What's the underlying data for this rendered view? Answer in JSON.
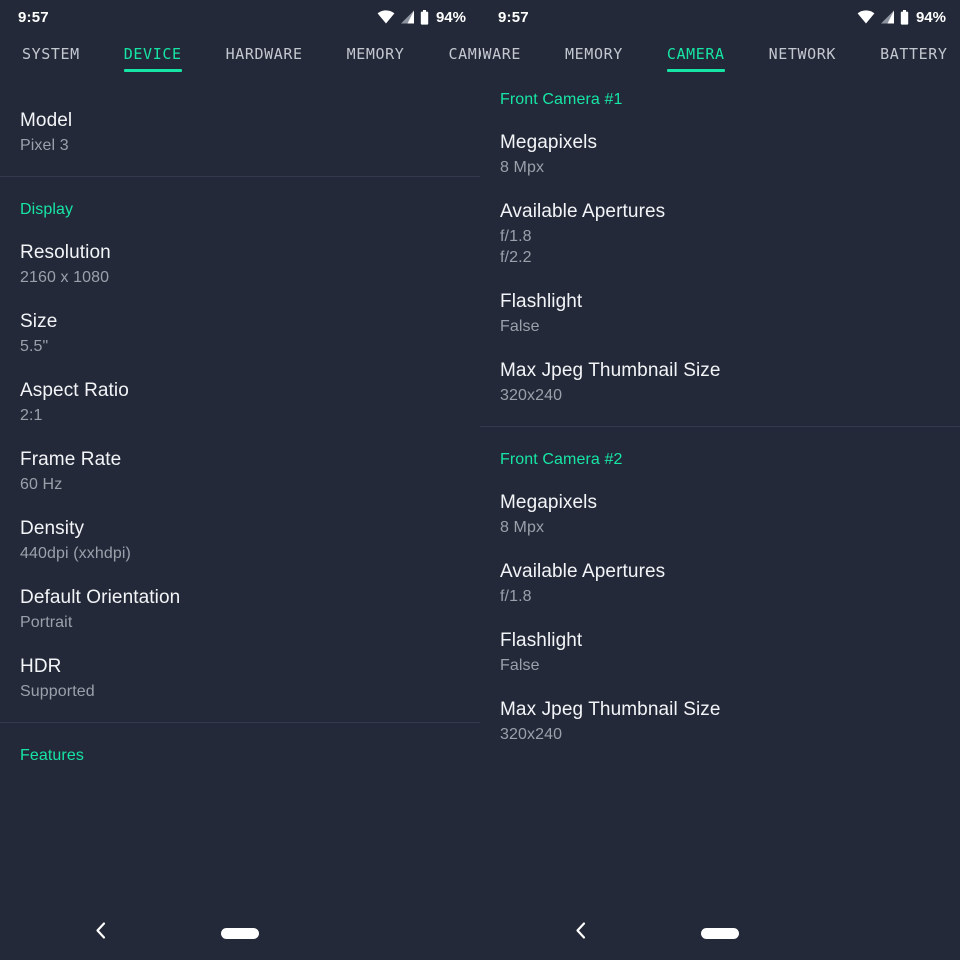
{
  "accent_color": "#17e5a5",
  "background_color": "#232938",
  "label_color": "#f2f4f7",
  "value_color": "#9aa1ab",
  "left": {
    "status": {
      "clock": "9:57",
      "battery_percent": "94%",
      "icons": [
        "wifi-icon",
        "cell-signal-icon",
        "battery-icon"
      ]
    },
    "tabs": [
      {
        "label": "SYSTEM",
        "active": false
      },
      {
        "label": "DEVICE",
        "active": true
      },
      {
        "label": "HARDWARE",
        "active": false
      },
      {
        "label": "MEMORY",
        "active": false
      },
      {
        "label": "CAMERA HARDWARE",
        "active": false
      }
    ],
    "sections": [
      {
        "header": null,
        "rows": [
          {
            "label": "Model",
            "values": [
              "Pixel 3"
            ]
          }
        ]
      },
      {
        "header": "Display",
        "rows": [
          {
            "label": "Resolution",
            "values": [
              "2160 x 1080"
            ]
          },
          {
            "label": "Size",
            "values": [
              "5.5\""
            ]
          },
          {
            "label": "Aspect Ratio",
            "values": [
              "2:1"
            ]
          },
          {
            "label": "Frame Rate",
            "values": [
              "60 Hz"
            ]
          },
          {
            "label": "Density",
            "values": [
              "440dpi (xxhdpi)"
            ]
          },
          {
            "label": "Default Orientation",
            "values": [
              "Portrait"
            ]
          },
          {
            "label": "HDR",
            "values": [
              "Supported"
            ]
          }
        ]
      },
      {
        "header": "Features",
        "rows": []
      }
    ],
    "nav": {
      "back": "back-chevron-icon",
      "home": "home-pill-icon"
    }
  },
  "right": {
    "status": {
      "clock": "9:57",
      "battery_percent": "94%",
      "icons": [
        "wifi-icon",
        "cell-signal-icon",
        "battery-icon"
      ]
    },
    "tabs": [
      {
        "label": "HARDWARE",
        "active": false
      },
      {
        "label": "MEMORY",
        "active": false
      },
      {
        "label": "CAMERA",
        "active": true
      },
      {
        "label": "NETWORK",
        "active": false
      },
      {
        "label": "BATTERY",
        "active": false
      }
    ],
    "sections": [
      {
        "header": "Front Camera #1",
        "rows": [
          {
            "label": "Megapixels",
            "values": [
              "8 Mpx"
            ]
          },
          {
            "label": "Available Apertures",
            "values": [
              "f/1.8",
              "f/2.2"
            ]
          },
          {
            "label": "Flashlight",
            "values": [
              "False"
            ]
          },
          {
            "label": "Max Jpeg Thumbnail Size",
            "values": [
              "320x240"
            ]
          }
        ]
      },
      {
        "header": "Front Camera #2",
        "rows": [
          {
            "label": "Megapixels",
            "values": [
              "8 Mpx"
            ]
          },
          {
            "label": "Available Apertures",
            "values": [
              "f/1.8"
            ]
          },
          {
            "label": "Flashlight",
            "values": [
              "False"
            ]
          },
          {
            "label": "Max Jpeg Thumbnail Size",
            "values": [
              "320x240"
            ]
          }
        ]
      }
    ],
    "nav": {
      "back": "back-chevron-icon",
      "home": "home-pill-icon"
    }
  }
}
